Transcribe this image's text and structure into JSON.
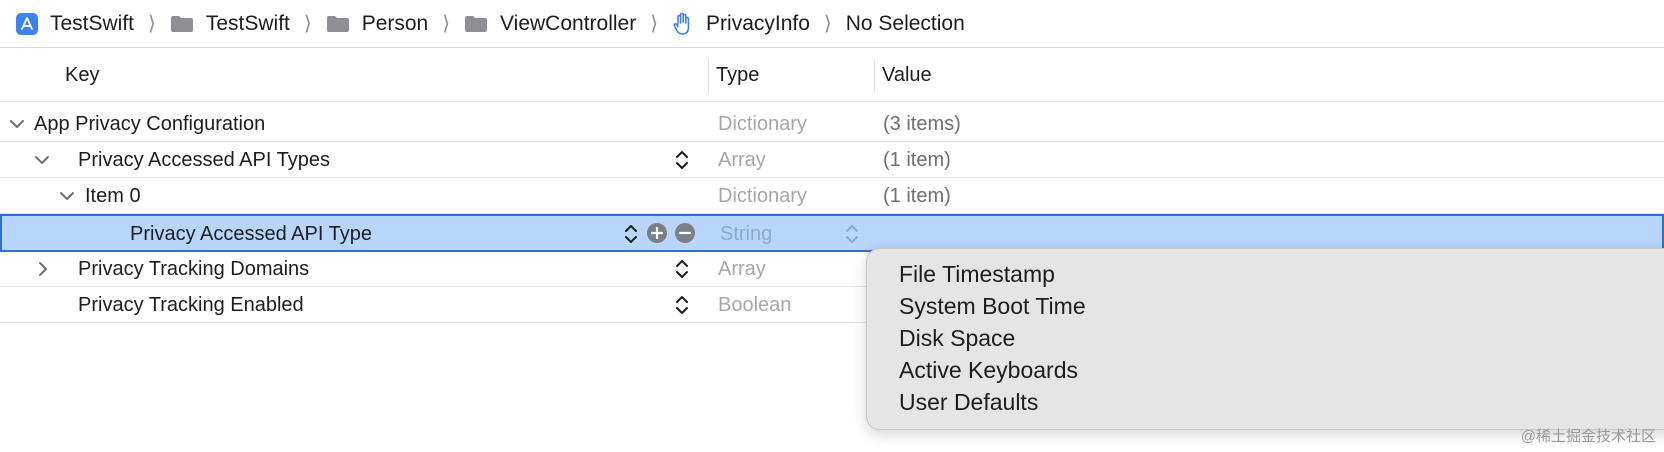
{
  "breadcrumb": {
    "items": [
      {
        "label": "TestSwift",
        "icon": "app-target-icon"
      },
      {
        "label": "TestSwift",
        "icon": "folder-icon"
      },
      {
        "label": "Person",
        "icon": "folder-icon"
      },
      {
        "label": "ViewController",
        "icon": "folder-icon"
      },
      {
        "label": "PrivacyInfo",
        "icon": "privacy-hand-icon"
      },
      {
        "label": "No Selection"
      }
    ],
    "separator": "⟩"
  },
  "columns": {
    "key": "Key",
    "type": "Type",
    "value": "Value"
  },
  "rows": [
    {
      "key": "App Privacy Configuration",
      "type": "Dictionary",
      "value": "(3 items)",
      "expanded": true
    },
    {
      "key": "Privacy Accessed API Types",
      "type": "Array",
      "value": "(1 item)",
      "expanded": true
    },
    {
      "key": "Item 0",
      "type": "Dictionary",
      "value": "(1 item)",
      "expanded": true
    },
    {
      "key": "Privacy Accessed API Type",
      "type": "String",
      "value": "",
      "selected": true
    },
    {
      "key": "Privacy Tracking Domains",
      "type": "Array",
      "value": "",
      "expanded": false
    },
    {
      "key": "Privacy Tracking Enabled",
      "type": "Boolean",
      "value": ""
    }
  ],
  "popup": {
    "items": [
      "File Timestamp",
      "System Boot Time",
      "Disk Space",
      "Active Keyboards",
      "User Defaults"
    ]
  },
  "watermark": "@稀土掘金技术社区",
  "colors": {
    "selection": "#b8d6fb",
    "selection_border": "#2f6fd8",
    "accent": "#3b82f6"
  }
}
